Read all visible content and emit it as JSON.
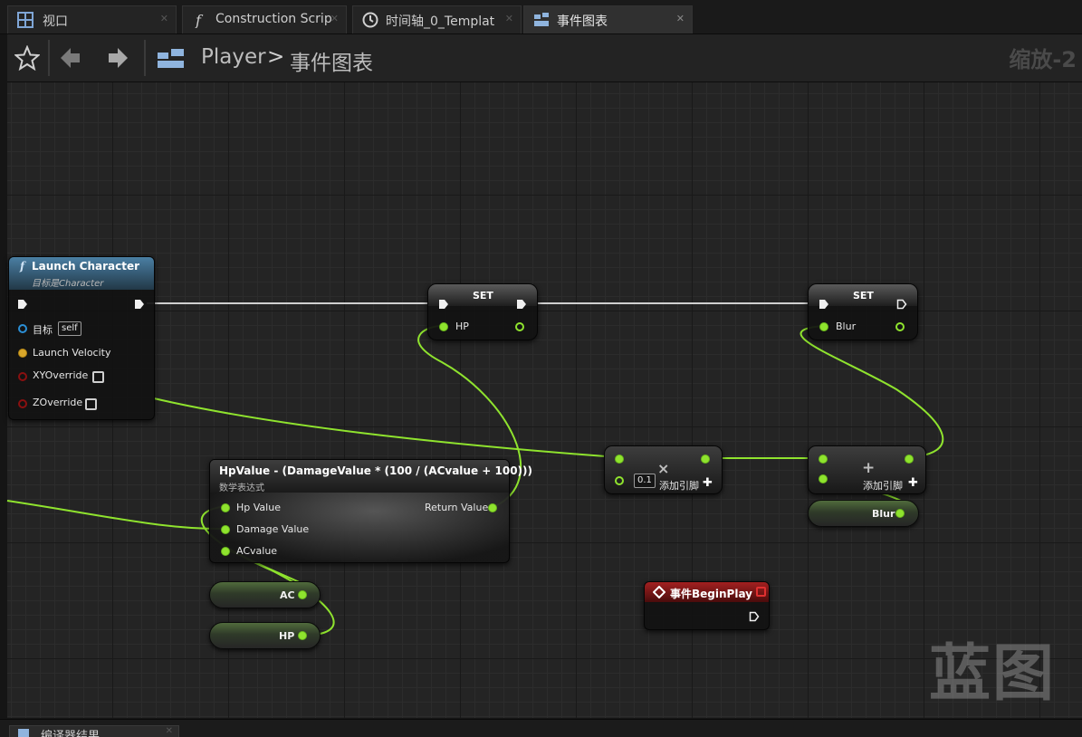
{
  "tabs": [
    {
      "label": "视口",
      "icon": "viewport-grid-icon",
      "active": false
    },
    {
      "label": "Construction Scrip",
      "icon": "function-icon",
      "active": false
    },
    {
      "label": "时间轴_0_Templat",
      "icon": "clock-icon",
      "active": false
    },
    {
      "label": "事件图表",
      "icon": "event-graph-icon",
      "active": true
    }
  ],
  "toolbar": {
    "breadcrumb_root": "Player",
    "breadcrumb_separator": ">",
    "breadcrumb_current": "事件图表",
    "zoom_label": "缩放-2"
  },
  "nodes": {
    "launch_character": {
      "title": "Launch Character",
      "subtitle": "目标是Character",
      "function_glyph": "f",
      "pins": {
        "target_label": "目标",
        "target_value": "self",
        "launch_velocity": "Launch Velocity",
        "xy_override": "XYOverride",
        "z_override": "ZOverride"
      }
    },
    "set_hp": {
      "title": "SET",
      "pin_label": "HP"
    },
    "set_blur": {
      "title": "SET",
      "pin_label": "Blur"
    },
    "math_expression": {
      "title": "HpValue - (DamageValue * (100 / (ACvalue + 100)))",
      "subtitle": "数学表达式",
      "inputs": [
        "Hp Value",
        "Damage Value",
        "ACvalue"
      ],
      "output": "Return Value"
    },
    "multiply": {
      "symbol": "×",
      "input_value": "0.1",
      "add_pin_label": "添加引脚"
    },
    "add": {
      "symbol": "+",
      "add_pin_label": "添加引脚"
    },
    "blur_getter": {
      "label": "Blur"
    },
    "ac_getter": {
      "label": "AC"
    },
    "hp_getter": {
      "label": "HP"
    },
    "begin_play": {
      "title": "事件BeginPlay"
    }
  },
  "watermark": "蓝图",
  "bottom_panel": {
    "tab_label": "编译器结果",
    "icon": "compiler-results-icon"
  },
  "colors": {
    "float_pin": "#8fe32e",
    "object_pin": "#2b8fd6",
    "vector_pin": "#d8a62a",
    "bool_pin": "#8a1010",
    "function_header": "#3b6c8c",
    "event_header": "#8a1a1a",
    "wire": "#8fe32e",
    "exec_wire": "#d8d8d8"
  }
}
